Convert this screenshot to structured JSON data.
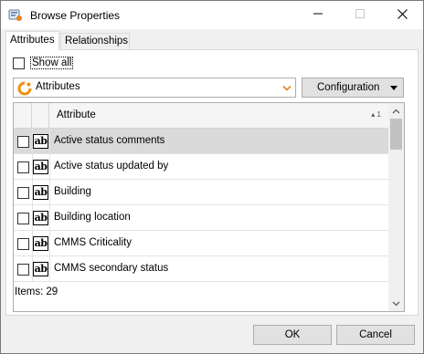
{
  "window": {
    "title": "Browse Properties",
    "icons": {
      "app": "properties-app-icon",
      "minimize": "minimize-icon",
      "maximize": "maximize-icon",
      "close": "close-icon"
    }
  },
  "tabs": [
    {
      "label": "Attributes",
      "active": true
    },
    {
      "label": "Relationships",
      "active": false
    }
  ],
  "show_all": {
    "label": "Show all",
    "checked": false
  },
  "source_combo": {
    "value": "Attributes",
    "icon": "attributes-source-icon"
  },
  "configuration_button": {
    "label": "Configuration"
  },
  "grid": {
    "columns": [
      {
        "label": ""
      },
      {
        "label": ""
      },
      {
        "label": "Attribute",
        "sort_order": "1"
      }
    ],
    "type_icon": "ab",
    "rows": [
      {
        "label": "Active status comments",
        "checked": false,
        "selected": true
      },
      {
        "label": "Active status updated by",
        "checked": false,
        "selected": false
      },
      {
        "label": "Building",
        "checked": false,
        "selected": false
      },
      {
        "label": "Building location",
        "checked": false,
        "selected": false
      },
      {
        "label": "CMMS Criticality",
        "checked": false,
        "selected": false
      },
      {
        "label": "CMMS secondary status",
        "checked": false,
        "selected": false
      }
    ]
  },
  "footer": {
    "items_label": "Items:",
    "items_count": "29"
  },
  "buttons": {
    "ok": "OK",
    "cancel": "Cancel"
  },
  "colors": {
    "accent_orange": "#f0900f",
    "selected_row": "#dadada",
    "button_face": "#e1e1e1"
  }
}
